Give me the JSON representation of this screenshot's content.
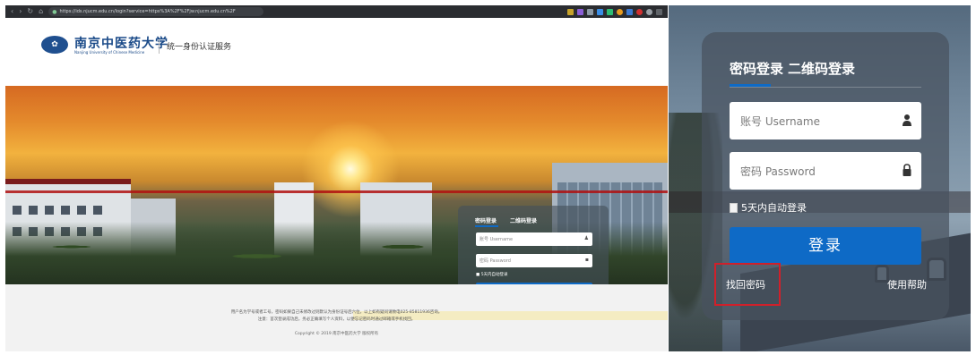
{
  "browser": {
    "url": "https://ids.njucm.edu.cn/authserver/login?service=https%3A%2F%2Fjw.njucm.edu.cn%2F",
    "url_display": "https://ids.njucm.edu.cn/login?service=https%3A%2F%2Fjw.njucm.edu.cn%2F"
  },
  "header": {
    "logo_cn": "南京中医药大学",
    "logo_en": "Nanjing University of Chinese Medicine",
    "service_title": "统一身份认证服务"
  },
  "login": {
    "tab_password": "密码登录",
    "tab_qrcode": "二维码登录",
    "username_placeholder": "账号 Username",
    "password_placeholder": "密码 Password",
    "remember_label": "5天内自动登录",
    "login_button": "登 录",
    "login_button_zoom": "登录",
    "forgot_label": "找回密码",
    "help_label": "使用帮助"
  },
  "footer": {
    "notice_line1": "用户名为学号或者工号，密码如果自己未修改过则默认为身份证号后六位，以上如有疑问请致电025-85811936咨询。",
    "notice_line2": "注意：首次登录成功后，务必正确填写个人资料，以便忘记密码时通过邮箱或手机找回。",
    "copyright": "Copyright © 2019 南京中医药大学 版权所有"
  },
  "colors": {
    "accent": "#0e6ac6",
    "highlight_border": "#d0202a",
    "card_bg": "rgba(72,82,94,0.72)"
  }
}
